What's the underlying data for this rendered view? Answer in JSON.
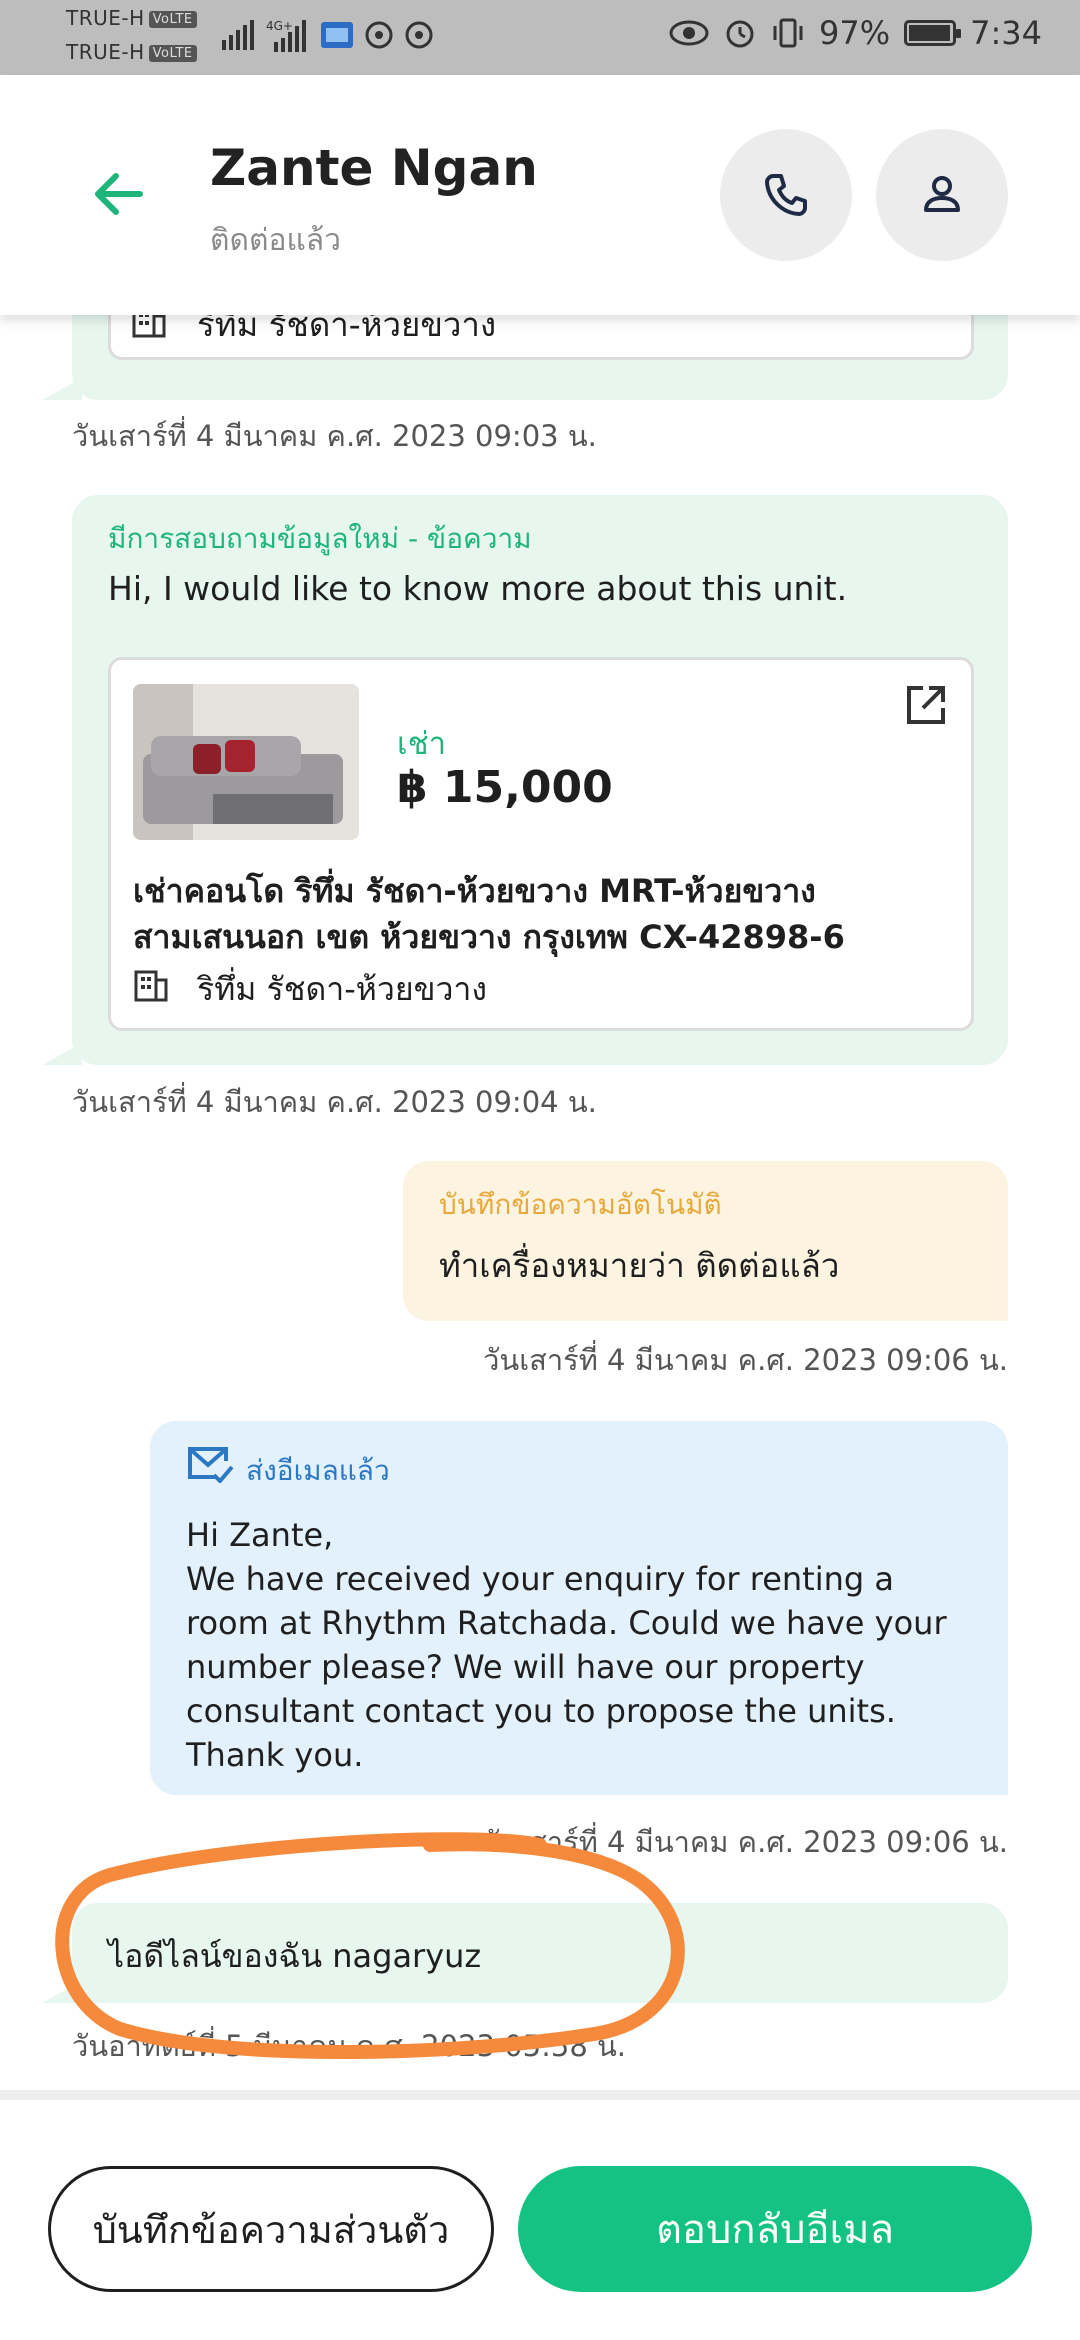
{
  "status_bar": {
    "carrier_1": "TRUE-H",
    "carrier_2": "TRUE-H",
    "volte": "VoLTE",
    "network": "4G+",
    "battery": "97%",
    "battery_level": 0.97,
    "time": "7:34"
  },
  "header": {
    "name": "Zante Ngan",
    "status": "ติดต่อแล้ว",
    "back_icon": "arrow-left-icon",
    "call_icon": "phone-icon",
    "profile_icon": "person-icon",
    "accent_color": "#1db57a"
  },
  "messages": {
    "partial_card_project": "ริทึ่ม รัชดา-ห้วยขวาง",
    "timestamp_1": "วันเสาร์ที่ 4 มีนาคม ค.ศ. 2023 09:03 น.",
    "enquiry": {
      "title": "มีการสอบถามข้อมูลใหม่ - ข้อความ",
      "text": "Hi, I would like to know more about this unit.",
      "listing": {
        "type": "เช่า",
        "price": "฿ 15,000",
        "title_line1": "เช่าคอนโด  ริทึ่ม รัชดา-ห้วยขวาง MRT-ห้วยขวาง",
        "title_line2": "สามเสนนอก เขต ห้วยขวาง กรุงเทพ CX-42898-6",
        "project": "ริทึ่ม รัชดา-ห้วยขวาง"
      }
    },
    "timestamp_2": "วันเสาร์ที่ 4 มีนาคม ค.ศ. 2023 09:04 น.",
    "auto_note": {
      "title": "บันทึกข้อความอัตโนมัติ",
      "text": "ทำเครื่องหมายว่า ติดต่อแล้ว",
      "title_color": "#e8a93b"
    },
    "timestamp_3": "วันเสาร์ที่ 4 มีนาคม ค.ศ. 2023 09:06 น.",
    "email": {
      "title": "ส่งอีเมลแล้ว",
      "lines": [
        "Hi Zante,",
        "We have received your enquiry for renting a",
        "room at Rhythm Ratchada. Could we have your",
        "number please? We will have our property",
        "consultant contact you to propose the units.",
        "Thank you."
      ],
      "title_color": "#2b78c5"
    },
    "timestamp_4": "วันเสาร์ที่ 4 มีนาคม ค.ศ. 2023 09:06 น.",
    "reply": {
      "text": "ไอดีไลน์ของฉัน nagaryuz"
    },
    "timestamp_5": "วันอาทิตย์ที่ 5 มีนาคม ค.ศ. 2023 05:58 น."
  },
  "bottom_bar": {
    "private_note_label": "บันทึกข้อความส่วนตัว",
    "reply_email_label": "ตอบกลับอีเมล"
  },
  "annotation_color": "#f58a3c"
}
